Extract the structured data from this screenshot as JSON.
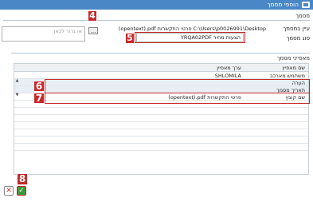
{
  "window": {
    "title": "הוספי מסמך"
  },
  "document_section": {
    "heading": "מסמך",
    "file_label": "עיין במסמך",
    "file_value": "(opentext).pdf פרטי התקשרות C:\\Users\\p0026991\\Desktop",
    "browse_label": "...",
    "type_label": "סוג מסמך",
    "type_value": "YRQA02PDF הצעות מחיר",
    "drop_placeholder": "או גרור לכאן"
  },
  "attributes_section": {
    "heading": "מאפייני מסמך",
    "columns": {
      "name": "שם מאפיין",
      "value": "ערך מאפיין"
    },
    "rows": [
      {
        "name": "משתמש מארכב",
        "value": "SHLOMILA"
      },
      {
        "name": "הערה",
        "value": ""
      },
      {
        "name": "תאריך מסמך",
        "value": ""
      },
      {
        "name": "שם קובץ",
        "value": "(opentext).pdf פרטי התקשרות"
      }
    ]
  },
  "markers": {
    "m4": "4",
    "m5": "5",
    "m6": "6",
    "m7": "7",
    "m8": "8"
  },
  "icons": {
    "window": "add-document-icon",
    "cancel": "cancel-icon",
    "confirm": "confirm-check-icon",
    "scroll_up": "scroll-up-icon",
    "scroll_down": "scroll-down-icon"
  },
  "colors": {
    "titlebar": "#4a87c7",
    "marker": "#c62828",
    "confirm": "#3a9a3a",
    "cancel": "#d32f2f"
  }
}
